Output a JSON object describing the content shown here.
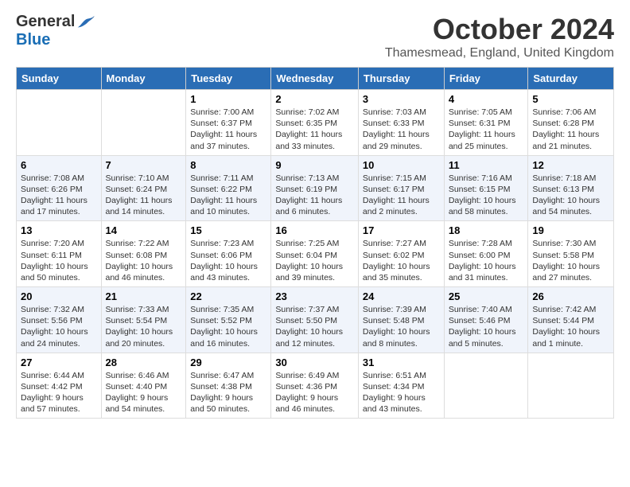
{
  "header": {
    "logo_general": "General",
    "logo_blue": "Blue",
    "month": "October 2024",
    "location": "Thamesmead, England, United Kingdom"
  },
  "days_of_week": [
    "Sunday",
    "Monday",
    "Tuesday",
    "Wednesday",
    "Thursday",
    "Friday",
    "Saturday"
  ],
  "weeks": [
    [
      {
        "day": "",
        "text": ""
      },
      {
        "day": "",
        "text": ""
      },
      {
        "day": "1",
        "text": "Sunrise: 7:00 AM\nSunset: 6:37 PM\nDaylight: 11 hours and 37 minutes."
      },
      {
        "day": "2",
        "text": "Sunrise: 7:02 AM\nSunset: 6:35 PM\nDaylight: 11 hours and 33 minutes."
      },
      {
        "day": "3",
        "text": "Sunrise: 7:03 AM\nSunset: 6:33 PM\nDaylight: 11 hours and 29 minutes."
      },
      {
        "day": "4",
        "text": "Sunrise: 7:05 AM\nSunset: 6:31 PM\nDaylight: 11 hours and 25 minutes."
      },
      {
        "day": "5",
        "text": "Sunrise: 7:06 AM\nSunset: 6:28 PM\nDaylight: 11 hours and 21 minutes."
      }
    ],
    [
      {
        "day": "6",
        "text": "Sunrise: 7:08 AM\nSunset: 6:26 PM\nDaylight: 11 hours and 17 minutes."
      },
      {
        "day": "7",
        "text": "Sunrise: 7:10 AM\nSunset: 6:24 PM\nDaylight: 11 hours and 14 minutes."
      },
      {
        "day": "8",
        "text": "Sunrise: 7:11 AM\nSunset: 6:22 PM\nDaylight: 11 hours and 10 minutes."
      },
      {
        "day": "9",
        "text": "Sunrise: 7:13 AM\nSunset: 6:19 PM\nDaylight: 11 hours and 6 minutes."
      },
      {
        "day": "10",
        "text": "Sunrise: 7:15 AM\nSunset: 6:17 PM\nDaylight: 11 hours and 2 minutes."
      },
      {
        "day": "11",
        "text": "Sunrise: 7:16 AM\nSunset: 6:15 PM\nDaylight: 10 hours and 58 minutes."
      },
      {
        "day": "12",
        "text": "Sunrise: 7:18 AM\nSunset: 6:13 PM\nDaylight: 10 hours and 54 minutes."
      }
    ],
    [
      {
        "day": "13",
        "text": "Sunrise: 7:20 AM\nSunset: 6:11 PM\nDaylight: 10 hours and 50 minutes."
      },
      {
        "day": "14",
        "text": "Sunrise: 7:22 AM\nSunset: 6:08 PM\nDaylight: 10 hours and 46 minutes."
      },
      {
        "day": "15",
        "text": "Sunrise: 7:23 AM\nSunset: 6:06 PM\nDaylight: 10 hours and 43 minutes."
      },
      {
        "day": "16",
        "text": "Sunrise: 7:25 AM\nSunset: 6:04 PM\nDaylight: 10 hours and 39 minutes."
      },
      {
        "day": "17",
        "text": "Sunrise: 7:27 AM\nSunset: 6:02 PM\nDaylight: 10 hours and 35 minutes."
      },
      {
        "day": "18",
        "text": "Sunrise: 7:28 AM\nSunset: 6:00 PM\nDaylight: 10 hours and 31 minutes."
      },
      {
        "day": "19",
        "text": "Sunrise: 7:30 AM\nSunset: 5:58 PM\nDaylight: 10 hours and 27 minutes."
      }
    ],
    [
      {
        "day": "20",
        "text": "Sunrise: 7:32 AM\nSunset: 5:56 PM\nDaylight: 10 hours and 24 minutes."
      },
      {
        "day": "21",
        "text": "Sunrise: 7:33 AM\nSunset: 5:54 PM\nDaylight: 10 hours and 20 minutes."
      },
      {
        "day": "22",
        "text": "Sunrise: 7:35 AM\nSunset: 5:52 PM\nDaylight: 10 hours and 16 minutes."
      },
      {
        "day": "23",
        "text": "Sunrise: 7:37 AM\nSunset: 5:50 PM\nDaylight: 10 hours and 12 minutes."
      },
      {
        "day": "24",
        "text": "Sunrise: 7:39 AM\nSunset: 5:48 PM\nDaylight: 10 hours and 8 minutes."
      },
      {
        "day": "25",
        "text": "Sunrise: 7:40 AM\nSunset: 5:46 PM\nDaylight: 10 hours and 5 minutes."
      },
      {
        "day": "26",
        "text": "Sunrise: 7:42 AM\nSunset: 5:44 PM\nDaylight: 10 hours and 1 minute."
      }
    ],
    [
      {
        "day": "27",
        "text": "Sunrise: 6:44 AM\nSunset: 4:42 PM\nDaylight: 9 hours and 57 minutes."
      },
      {
        "day": "28",
        "text": "Sunrise: 6:46 AM\nSunset: 4:40 PM\nDaylight: 9 hours and 54 minutes."
      },
      {
        "day": "29",
        "text": "Sunrise: 6:47 AM\nSunset: 4:38 PM\nDaylight: 9 hours and 50 minutes."
      },
      {
        "day": "30",
        "text": "Sunrise: 6:49 AM\nSunset: 4:36 PM\nDaylight: 9 hours and 46 minutes."
      },
      {
        "day": "31",
        "text": "Sunrise: 6:51 AM\nSunset: 4:34 PM\nDaylight: 9 hours and 43 minutes."
      },
      {
        "day": "",
        "text": ""
      },
      {
        "day": "",
        "text": ""
      }
    ]
  ]
}
